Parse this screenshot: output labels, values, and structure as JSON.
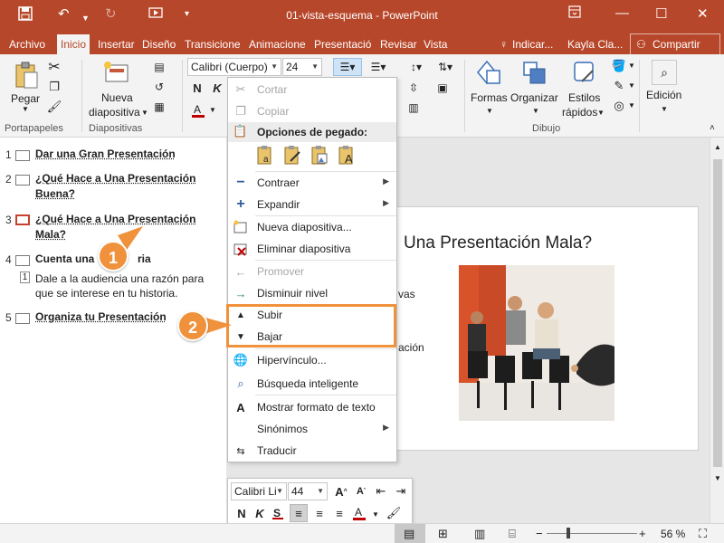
{
  "app": {
    "title": "01-vista-esquema  -  PowerPoint",
    "accent_color": "#b7472a",
    "highlight_color": "#f0913b",
    "user": "Kayla Cla...",
    "tell_me": "Indicar...",
    "share_label": "Compartir"
  },
  "tabs": [
    "Archivo",
    "Inicio",
    "Insertar",
    "Diseño",
    "Transicione",
    "Animacione",
    "Presentació",
    "Revisar",
    "Vista"
  ],
  "ribbon": {
    "paste_label": "Pegar",
    "new_slide_label_1": "Nueva",
    "new_slide_label_2": "diapositiva",
    "font_name": "Calibri (Cuerpo)",
    "font_size": "24",
    "bold": "N",
    "italic": "K",
    "shapes": "Formas",
    "arrange": "Organizar",
    "styles_1": "Estilos",
    "styles_2": "rápidos",
    "editing": "Edición",
    "groups": {
      "clipboard": "Portapapeles",
      "slides": "Diapositivas",
      "drawing": "Dibujo"
    }
  },
  "outline": {
    "items": [
      {
        "num": "1",
        "text": "Dar una Gran Presentación"
      },
      {
        "num": "2",
        "text_1": "¿Qué Hace a Una Presentación",
        "text_2": "Buena?"
      },
      {
        "num": "3",
        "text_1": "¿Qué Hace a Una Presentación",
        "text_2": "Mala?"
      },
      {
        "num": "4",
        "text_a": "Cuenta una",
        "text_b": "ria"
      },
      {
        "num": "5",
        "text": "Organiza tu Presentación"
      }
    ],
    "sub_num": "1",
    "sub_text_1": "Dale a la audiencia una razón para",
    "sub_text_2": "que se interese en tu historia."
  },
  "slide": {
    "title": "Una Presentación Mala?",
    "frag_1": "vas",
    "frag_2": "ación"
  },
  "context_menu": {
    "cut": "Cortar",
    "copy": "Copiar",
    "paste_options": "Opciones de pegado:",
    "collapse": "Contraer",
    "expand": "Expandir",
    "new_slide": "Nueva diapositiva...",
    "delete_slide": "Eliminar diapositiva",
    "promote": "Promover",
    "demote": "Disminuir nivel",
    "move_up": "Subir",
    "move_down": "Bajar",
    "hyperlink": "Hipervínculo...",
    "smart_lookup": "Búsqueda inteligente",
    "show_formatting": "Mostrar formato de texto",
    "synonyms": "Sinónimos",
    "translate": "Traducir"
  },
  "callouts": [
    "1",
    "2"
  ],
  "mini_toolbar": {
    "font": "Calibri Li",
    "size": "44",
    "bold": "N",
    "italic": "K",
    "underline_color": "#c00000",
    "font_color": "#c00000"
  },
  "statusbar": {
    "zoom": "56 %"
  }
}
